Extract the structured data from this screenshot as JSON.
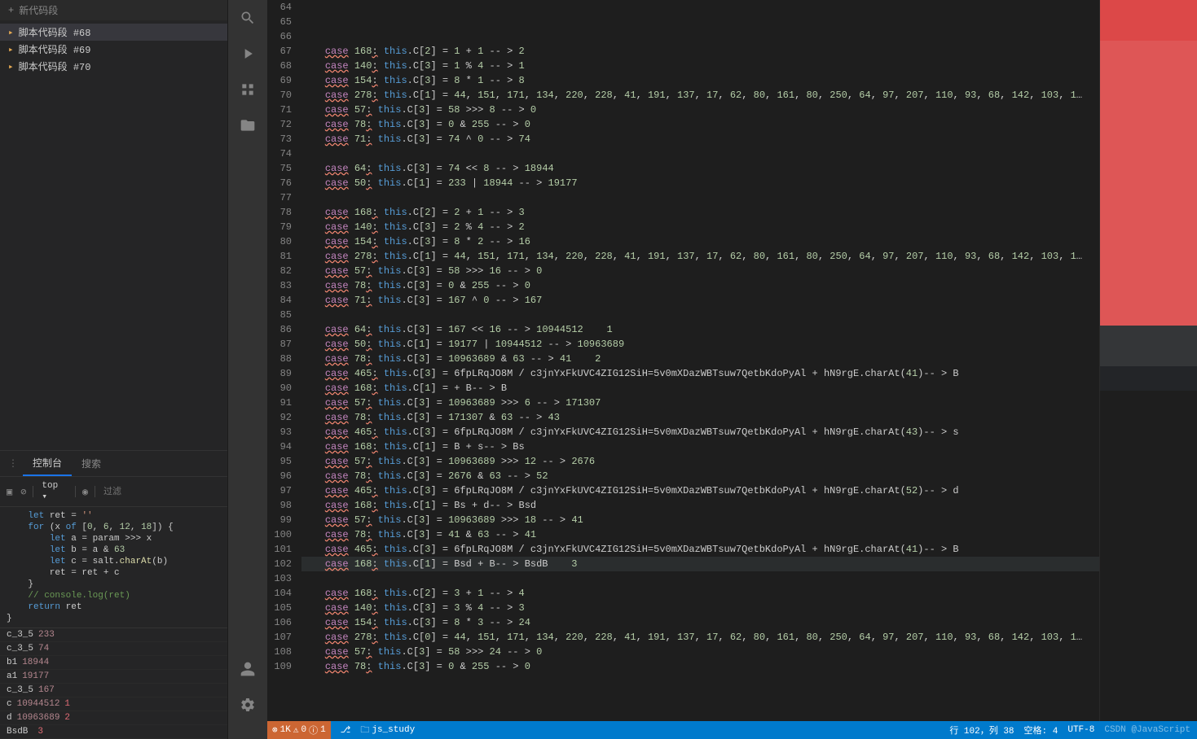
{
  "left": {
    "new_snippet": "新代码段",
    "items": [
      "脚本代码段 #68",
      "脚本代码段 #69",
      "脚本代码段 #70"
    ]
  },
  "console": {
    "tab_console": "控制台",
    "tab_search": "搜索",
    "scope": "top ▾",
    "filter_placeholder": "过滤",
    "code": "    let ret = ''\n    for (x of [0, 6, 12, 18]) {\n        let a = param >>> x\n        let b = a & 63\n        let c = salt.charAt(b)\n        ret = ret + c\n    }\n    // console.log(ret)\n    return ret\n}",
    "results": [
      {
        "n": "c_3_5",
        "v": "233"
      },
      {
        "n": "c_3_5",
        "v": "74"
      },
      {
        "n": "b1",
        "v": "18944"
      },
      {
        "n": "a1",
        "v": "19177"
      },
      {
        "n": "c_3_5",
        "v": "167"
      },
      {
        "n": "c",
        "v": "10944512",
        "a": "1"
      },
      {
        "n": "d",
        "v": "10963689",
        "a": "2"
      },
      {
        "n": "BsdB",
        "v": "",
        "a": "3"
      }
    ]
  },
  "editor": {
    "first_line": 64,
    "lines": [
      "",
      "",
      "",
      "case 168: this.C[2] = 1 + 1 -- > 2",
      "case 140: this.C[3] = 1 % 4 -- > 1",
      "case 154: this.C[3] = 8 * 1 -- > 8",
      "case 278: this.C[1] = 44, 151, 171, 134, 220, 228, 41, 191, 137, 17, 62, 80, 161, 80, 250, 64, 97, 207, 110, 93, 68, 142, 103, 1…",
      "case 57: this.C[3] = 58 >>> 8 -- > 0",
      "case 78: this.C[3] = 0 & 255 -- > 0",
      "case 71: this.C[3] = 74 ^ 0 -- > 74",
      "",
      "case 64: this.C[3] = 74 << 8 -- > 18944",
      "case 50: this.C[1] = 233 | 18944 -- > 19177",
      "",
      "case 168: this.C[2] = 2 + 1 -- > 3",
      "case 140: this.C[3] = 2 % 4 -- > 2",
      "case 154: this.C[3] = 8 * 2 -- > 16",
      "case 278: this.C[1] = 44, 151, 171, 134, 220, 228, 41, 191, 137, 17, 62, 80, 161, 80, 250, 64, 97, 207, 110, 93, 68, 142, 103, 1…",
      "case 57: this.C[3] = 58 >>> 16 -- > 0",
      "case 78: this.C[3] = 0 & 255 -- > 0",
      "case 71: this.C[3] = 167 ^ 0 -- > 167",
      "",
      "case 64: this.C[3] = 167 << 16 -- > 10944512    1",
      "case 50: this.C[1] = 19177 | 10944512 -- > 10963689",
      "case 78: this.C[3] = 10963689 & 63 -- > 41    2",
      "case 465: this.C[3] = 6fpLRqJO8M / c3jnYxFkUVC4ZIG12SiH=5v0mXDazWBTsuw7QetbKdoPyAl + hN9rgE.charAt(41)-- > B",
      "case 168: this.C[1] = + B-- > B",
      "case 57: this.C[3] = 10963689 >>> 6 -- > 171307",
      "case 78: this.C[3] = 171307 & 63 -- > 43",
      "case 465: this.C[3] = 6fpLRqJO8M / c3jnYxFkUVC4ZIG12SiH=5v0mXDazWBTsuw7QetbKdoPyAl + hN9rgE.charAt(43)-- > s",
      "case 168: this.C[1] = B + s-- > Bs",
      "case 57: this.C[3] = 10963689 >>> 12 -- > 2676",
      "case 78: this.C[3] = 2676 & 63 -- > 52",
      "case 465: this.C[3] = 6fpLRqJO8M / c3jnYxFkUVC4ZIG12SiH=5v0mXDazWBTsuw7QetbKdoPyAl + hN9rgE.charAt(52)-- > d",
      "case 168: this.C[1] = Bs + d-- > Bsd",
      "case 57: this.C[3] = 10963689 >>> 18 -- > 41",
      "case 78: this.C[3] = 41 & 63 -- > 41",
      "case 465: this.C[3] = 6fpLRqJO8M / c3jnYxFkUVC4ZIG12SiH=5v0mXDazWBTsuw7QetbKdoPyAl + hN9rgE.charAt(41)-- > B",
      "case 168: this.C[1] = Bsd + B-- > BsdB    3",
      "",
      "case 168: this.C[2] = 3 + 1 -- > 4",
      "case 140: this.C[3] = 3 % 4 -- > 3",
      "case 154: this.C[3] = 8 * 3 -- > 24",
      "case 278: this.C[0] = 44, 151, 171, 134, 220, 228, 41, 191, 137, 17, 62, 80, 161, 80, 250, 64, 97, 207, 110, 93, 68, 142, 103, 1…",
      "case 57: this.C[3] = 58 >>> 24 -- > 0",
      "case 78: this.C[3] = 0 & 255 -- > 0"
    ]
  },
  "status": {
    "errors": "1K",
    "warnings": "0",
    "info": "1",
    "folder": "js_study",
    "line_col": "行 102，列 38",
    "spaces": "空格: 4",
    "encoding": "UTF-8",
    "watermark": "CSDN @JavaScript"
  }
}
